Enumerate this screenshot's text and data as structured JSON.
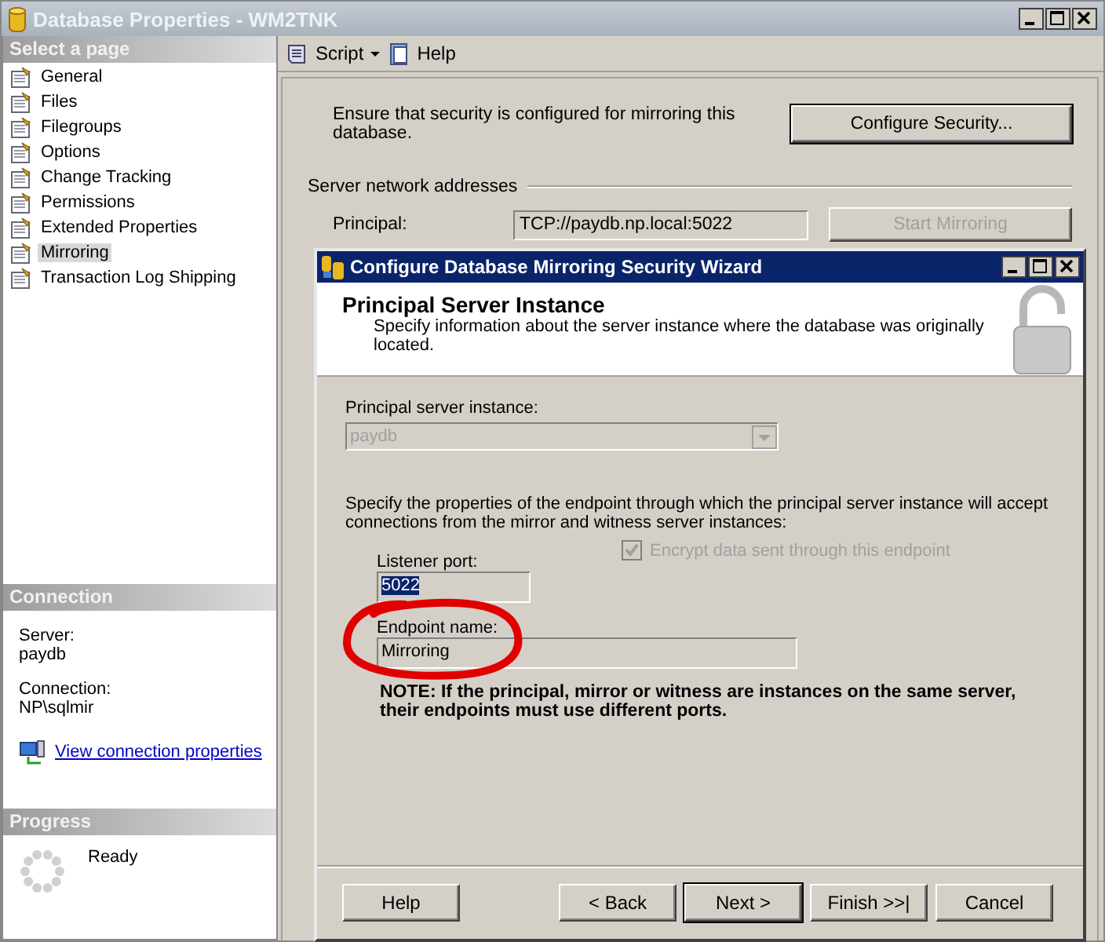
{
  "window": {
    "title": "Database Properties - WM2TNK"
  },
  "sidebar": {
    "header": "Select a page",
    "items": [
      {
        "label": "General",
        "selected": false
      },
      {
        "label": "Files",
        "selected": false
      },
      {
        "label": "Filegroups",
        "selected": false
      },
      {
        "label": "Options",
        "selected": false
      },
      {
        "label": "Change Tracking",
        "selected": false
      },
      {
        "label": "Permissions",
        "selected": false
      },
      {
        "label": "Extended Properties",
        "selected": false
      },
      {
        "label": "Mirroring",
        "selected": true
      },
      {
        "label": "Transaction Log Shipping",
        "selected": false
      }
    ]
  },
  "toolbar": {
    "script": "Script",
    "help": "Help"
  },
  "mirroring": {
    "security_text": "Ensure that security is configured for mirroring this database.",
    "configure_button": "Configure Security...",
    "addresses_group": "Server network addresses",
    "principal_label": "Principal:",
    "principal_value": "TCP://paydb.np.local:5022",
    "start_button": {
      "label": "Start Mirroring",
      "disabled": true
    }
  },
  "connection": {
    "header": "Connection",
    "server_label": "Server:",
    "server": "paydb",
    "connection_label": "Connection:",
    "connection": "NP\\sqlmir",
    "link": "View connection properties"
  },
  "progress": {
    "header": "Progress",
    "status": "Ready"
  },
  "wizard": {
    "title": "Configure Database Mirroring Security Wizard",
    "heading": "Principal Server Instance",
    "description": "Specify information about the server instance where the database was originally located.",
    "instance_label": "Principal server instance:",
    "instance": {
      "value": "paydb",
      "disabled": true
    },
    "endpoint_text": "Specify the properties of the endpoint through which the principal server instance will accept connections from the mirror and witness server instances:",
    "port_label": "Listener port:",
    "port_value": "5022",
    "encrypt": {
      "label": "Encrypt data sent through this endpoint",
      "checked": true,
      "disabled": true
    },
    "endpoint_label": "Endpoint name:",
    "endpoint_value": "Mirroring",
    "note": "NOTE: If the principal, mirror or witness are instances on the same server, their endpoints must use different ports.",
    "buttons": [
      {
        "label": "Help",
        "default": false
      },
      {
        "label": "< Back",
        "default": false
      },
      {
        "label": "Next >",
        "default": true
      },
      {
        "label": "Finish >>|",
        "default": false
      },
      {
        "label": "Cancel",
        "default": false
      }
    ]
  }
}
